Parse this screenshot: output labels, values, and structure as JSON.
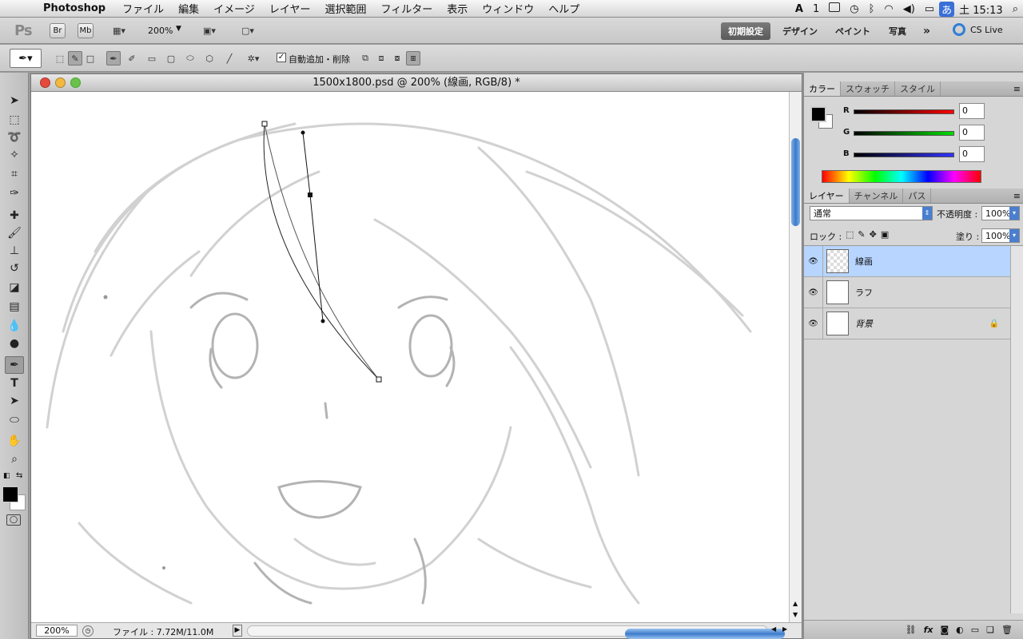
{
  "menubar": {
    "app_name": "Photoshop",
    "items": [
      "ファイル",
      "編集",
      "イメージ",
      "レイヤー",
      "選択範囲",
      "フィルター",
      "表示",
      "ウィンドウ",
      "ヘルプ"
    ],
    "right": {
      "adobe_count": "1",
      "clock": "土 15:13",
      "ime": "あ"
    }
  },
  "appbar": {
    "logo": "Ps",
    "br": "Br",
    "mb": "Mb",
    "zoom": "200%",
    "workspaces": [
      "初期設定",
      "デザイン",
      "ペイント",
      "写真"
    ],
    "more": "»",
    "cslive": "CS Live"
  },
  "options": {
    "auto_add_delete": "自動追加・削除"
  },
  "document": {
    "title": "1500x1800.psd @ 200% (線画, RGB/8) *",
    "zoom": "200%",
    "file_info": "ファイル : 7.72M/11.0M"
  },
  "color_panel": {
    "tabs": [
      "カラー",
      "スウォッチ",
      "スタイル"
    ],
    "channels": [
      {
        "label": "R",
        "value": "0",
        "color": "#e00000"
      },
      {
        "label": "G",
        "value": "0",
        "color": "#00c000"
      },
      {
        "label": "B",
        "value": "0",
        "color": "#2020e0"
      }
    ]
  },
  "layers_panel": {
    "tabs": [
      "レイヤー",
      "チャンネル",
      "パス"
    ],
    "blend_mode": "通常",
    "opacity_label": "不透明度 :",
    "opacity": "100%",
    "lock_label": "ロック :",
    "fill_label": "塗り :",
    "fill": "100%",
    "layers": [
      {
        "name": "線画",
        "selected": true
      },
      {
        "name": "ラフ",
        "selected": false
      },
      {
        "name": "背景",
        "selected": false,
        "locked": true
      }
    ]
  }
}
